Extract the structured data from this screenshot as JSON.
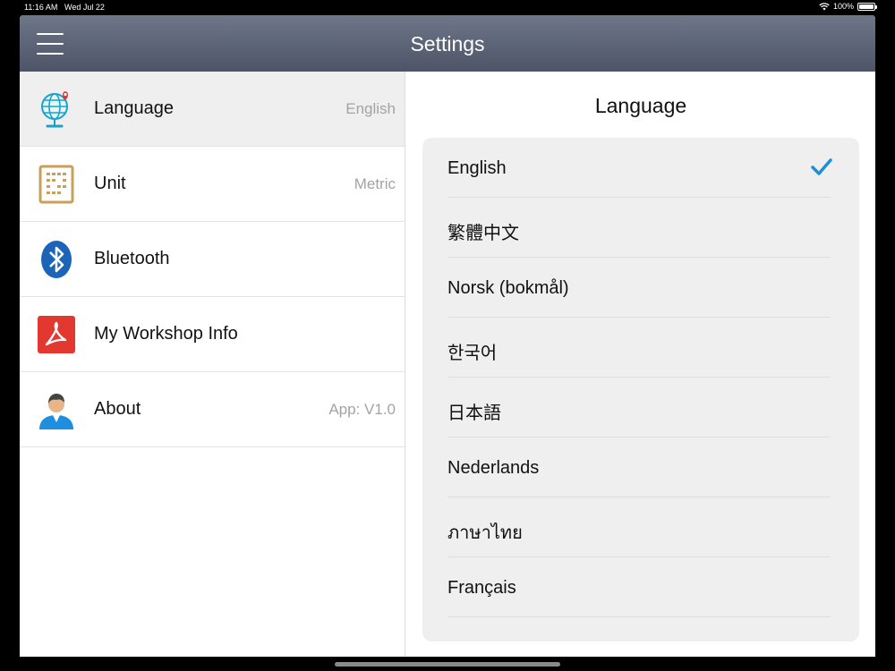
{
  "status_bar": {
    "time": "11:16 AM",
    "date": "Wed Jul 22",
    "battery": "100%"
  },
  "navbar": {
    "title": "Settings"
  },
  "settings": [
    {
      "label": "Language",
      "value": "English"
    },
    {
      "label": "Unit",
      "value": "Metric"
    },
    {
      "label": "Bluetooth",
      "value": ""
    },
    {
      "label": "My Workshop Info",
      "value": ""
    },
    {
      "label": "About",
      "value": "App: V1.0"
    }
  ],
  "detail": {
    "title": "Language",
    "selected": "English",
    "languages": [
      "English",
      "繁體中文",
      "Norsk (bokmål)",
      "한국어",
      "日本語",
      "Nederlands",
      "ภาษาไทย",
      "Français"
    ]
  },
  "colors": {
    "accent": "#1a8fe0",
    "navbar": "#5a6175"
  }
}
